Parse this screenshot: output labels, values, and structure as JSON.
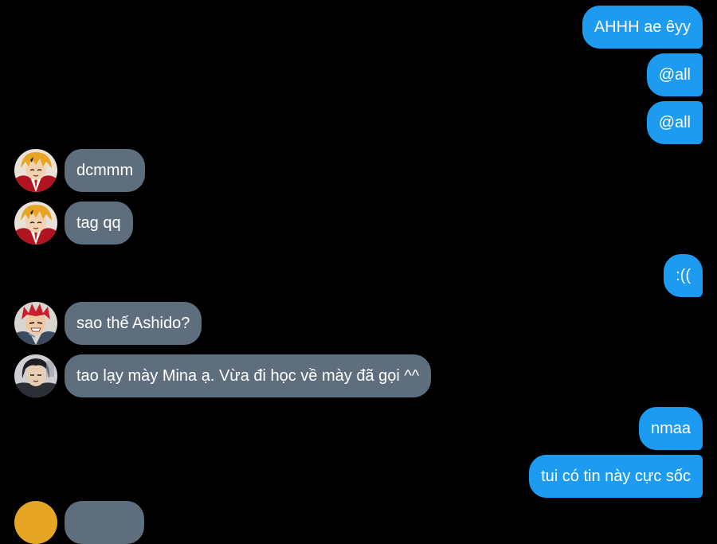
{
  "messages": [
    {
      "side": "out",
      "text": "AHHH ae êyy"
    },
    {
      "side": "out",
      "text": "@all"
    },
    {
      "side": "out",
      "text": "@all"
    },
    {
      "side": "in",
      "avatar": "denki-avatar",
      "text": "dcmmm"
    },
    {
      "side": "in",
      "avatar": "denki-avatar",
      "text": "tag qq"
    },
    {
      "side": "out",
      "text": ":(("
    },
    {
      "side": "in",
      "avatar": "kirishima-avatar",
      "text": "sao thế Ashido?"
    },
    {
      "side": "in",
      "avatar": "sero-avatar",
      "text": "tao lạy mày Mina ạ. Vừa đi học về mày đã gọi ^^"
    },
    {
      "side": "out",
      "text": "nmaa"
    },
    {
      "side": "out",
      "text": "tui có tin này cực sốc"
    }
  ],
  "colors": {
    "background": "#000000",
    "outgoing_bubble": "#1d9bf0",
    "incoming_bubble": "#5f6e7c",
    "text": "#ffffff"
  }
}
